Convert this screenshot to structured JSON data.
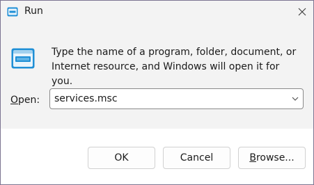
{
  "window": {
    "title": "Run",
    "title_icon": "run-icon",
    "close_icon": "close-icon"
  },
  "content": {
    "icon": "run-icon",
    "description_line1": "Type the name of a program, folder, document, or",
    "description_line2": "Internet resource, and Windows will open it for you.",
    "open_label_mnemonic": "O",
    "open_label_rest": "pen:",
    "open_value": "services.msc",
    "dropdown_icon": "chevron-down-icon"
  },
  "buttons": {
    "ok": "OK",
    "cancel": "Cancel",
    "browse_mnemonic": "B",
    "browse_rest": "rowse..."
  },
  "colors": {
    "accent": "#1f8fd6",
    "surface": "#f3f3f3",
    "footer": "#ffffff",
    "backdrop": "#7a6f8f"
  }
}
